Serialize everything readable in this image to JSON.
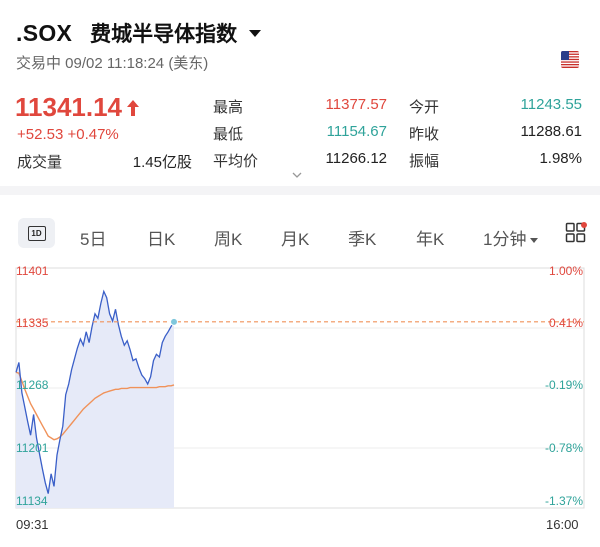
{
  "header": {
    "symbol": ".SOX",
    "name": "费城半导体指数",
    "status": "交易中 09/02 11:18:24 (美东)",
    "price": "11341.14",
    "change": "+52.53 +0.47%",
    "volume_label": "成交量",
    "volume_value": "1.45亿股",
    "stats": {
      "high_label": "最高",
      "high": "11377.57",
      "low_label": "最低",
      "low": "11154.67",
      "avg_label": "平均价",
      "avg": "11266.12",
      "open_label": "今开",
      "open": "11243.55",
      "prev_close_label": "昨收",
      "prev_close": "11288.61",
      "amplitude_label": "振幅",
      "amplitude": "1.98%"
    },
    "flag_icon": "us-flag-icon"
  },
  "tabs": {
    "t1d": "1D",
    "t5d": "5日",
    "day": "日K",
    "week": "周K",
    "month": "月K",
    "quarter": "季K",
    "year": "年K",
    "minute": "1分钟",
    "layout_icon": "grid-icon"
  },
  "colors": {
    "up": "#e0473d",
    "down": "#2fa39a",
    "avg_line": "#f0925a",
    "price_line": "#3a5fc8",
    "fill": "#e6eaf8"
  },
  "chart_data": {
    "type": "line",
    "y_left_ticks": [
      "11401",
      "11335",
      "11268",
      "11201",
      "11134"
    ],
    "y_right_ticks": [
      "1.00%",
      "0.41%",
      "-0.19%",
      "-0.78%",
      "-1.37%"
    ],
    "x_ticks": [
      "09:31",
      "16:00"
    ],
    "ylim": [
      11134,
      11401
    ],
    "prev_close": 11288.61,
    "last": 11341.14,
    "series": [
      {
        "values": [
          11285,
          11296,
          11262,
          11246,
          11230,
          11215,
          11238,
          11212,
          11195,
          11178,
          11162,
          11150,
          11172,
          11158,
          11193,
          11210,
          11225,
          11260,
          11272,
          11288,
          11300,
          11312,
          11322,
          11315,
          11330,
          11318,
          11336,
          11350,
          11345,
          11362,
          11375,
          11368,
          11350,
          11342,
          11355,
          11338,
          11325,
          11315,
          11320,
          11310,
          11298,
          11300,
          11290,
          11282,
          11278,
          11272,
          11280,
          11298,
          11305,
          11302,
          11318,
          11325,
          11330,
          11336,
          11341
        ]
      },
      {
        "values": [
          11285,
          11284,
          11275,
          11266,
          11258,
          11250,
          11244,
          11238,
          11232,
          11226,
          11220,
          11214,
          11212,
          11210,
          11211,
          11213,
          11216,
          11220,
          11224,
          11228,
          11232,
          11236,
          11240,
          11244,
          11247,
          11250,
          11253,
          11256,
          11258,
          11260,
          11262,
          11263,
          11264,
          11265,
          11266,
          11266,
          11267,
          11267,
          11267,
          11268,
          11268,
          11268,
          11268,
          11268,
          11268,
          11268,
          11268,
          11268,
          11268,
          11269,
          11269,
          11269,
          11270,
          11270,
          11271
        ]
      }
    ]
  }
}
